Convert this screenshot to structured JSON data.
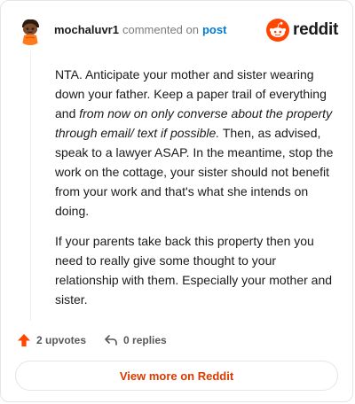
{
  "header": {
    "username": "mochaluvr1",
    "action_text": "commented on",
    "post_link": "post",
    "brand": "reddit"
  },
  "comment": {
    "p1_start": "NTA. Anticipate your mother and sister wearing down your father. Keep a paper trail of everything and ",
    "p1_italic": "from now on only converse about the property through email/ text if possible.",
    "p1_end": " Then, as advised, speak to a lawyer ASAP. In the meantime, stop the work on the cottage, your sister should not benefit from your work and that's what she intends on doing.",
    "p2": "If your parents take back this property then you need to really give some thought to your relationship with them. Especially your mother and sister."
  },
  "actions": {
    "upvotes": "2 upvotes",
    "replies": "0 replies"
  },
  "footer": {
    "view_more": "View more on Reddit"
  },
  "colors": {
    "brand_orange": "#ff4500",
    "link_blue": "#0079d3",
    "cta_red": "#d93a00"
  },
  "icons": {
    "avatar": "snoo-avatar",
    "brand": "reddit-snoo-icon",
    "upvote": "upvote-arrow-icon",
    "reply": "reply-arrow-icon"
  }
}
